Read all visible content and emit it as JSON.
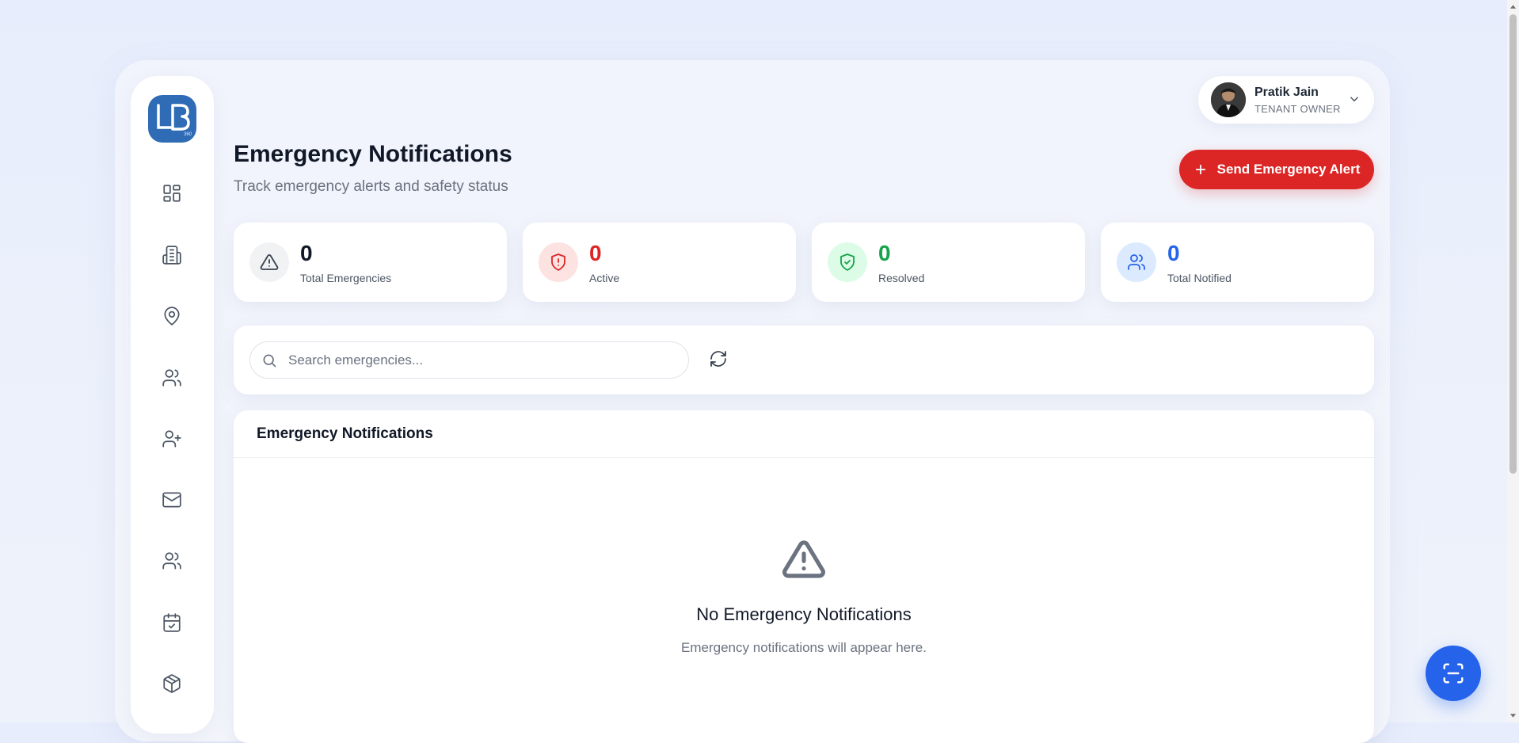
{
  "logo": {
    "text": "LB",
    "tagline": "360"
  },
  "sidebar": {
    "items": [
      {
        "icon": "dashboard-icon"
      },
      {
        "icon": "building-icon"
      },
      {
        "icon": "location-pin-icon"
      },
      {
        "icon": "users-icon"
      },
      {
        "icon": "user-plus-icon"
      },
      {
        "icon": "mail-icon"
      },
      {
        "icon": "team-icon"
      },
      {
        "icon": "calendar-check-icon"
      },
      {
        "icon": "package-icon"
      }
    ]
  },
  "user": {
    "name": "Pratik Jain",
    "role": "TENANT OWNER"
  },
  "header": {
    "title": "Emergency Notifications",
    "subtitle": "Track emergency alerts and safety status",
    "alert_button": "Send Emergency Alert"
  },
  "stats": [
    {
      "value": "0",
      "label": "Total Emergencies",
      "color": "#111827",
      "icon_bg": "#f1f2f4",
      "icon_color": "#374151"
    },
    {
      "value": "0",
      "label": "Active",
      "color": "#dc2626",
      "icon_bg": "#fde2e2",
      "icon_color": "#dc2626"
    },
    {
      "value": "0",
      "label": "Resolved",
      "color": "#16a34a",
      "icon_bg": "#dcfce7",
      "icon_color": "#16a34a"
    },
    {
      "value": "0",
      "label": "Total Notified",
      "color": "#2563eb",
      "icon_bg": "#dbeafe",
      "icon_color": "#2563eb"
    }
  ],
  "search": {
    "placeholder": "Search emergencies..."
  },
  "list": {
    "title": "Emergency Notifications",
    "empty_title": "No Emergency Notifications",
    "empty_subtitle": "Emergency notifications will appear here."
  },
  "colors": {
    "accent": "#2563eb",
    "danger": "#dc2626",
    "logo_bg": "#2f6cb5"
  }
}
